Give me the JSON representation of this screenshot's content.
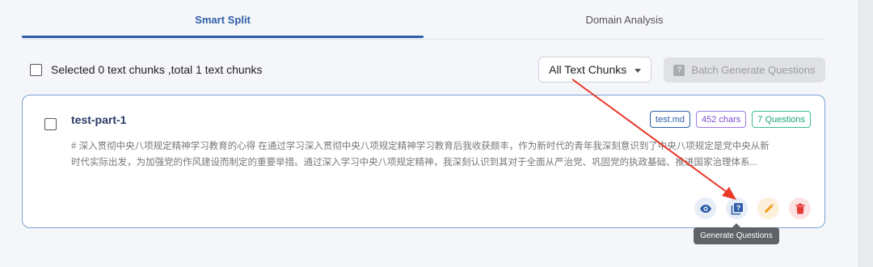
{
  "tabs": [
    {
      "label": "Smart Split",
      "active": true
    },
    {
      "label": "Domain Analysis",
      "active": false
    }
  ],
  "toolbar": {
    "selection_text": "Selected 0 text chunks ,total 1 text chunks",
    "filter_value": "All Text Chunks",
    "batch_button_label": "Batch Generate Questions",
    "batch_button_icon": "question-book-icon"
  },
  "chunk": {
    "title": "test-part-1",
    "tags": {
      "file": "test.md",
      "chars": "452 chars",
      "questions": "7 Questions"
    },
    "preview_line1": "# 深入贯彻中央八项规定精神学习教育的心得 在通过学习深入贯彻中央八项规定精神学习教育后我收获颇丰，作为新时代的青年我深刻意识到了中央八项规定是党中央从新",
    "preview_line2": "时代实际出发，为加强党的作风建设而制定的重要举措。通过深入学习中央八项规定精神，我深刻认识到其对于全面从严治党、巩固党的执政基础、推进国家治理体系...",
    "actions": [
      "eye-icon",
      "generate-questions-icon",
      "pencil-icon",
      "trash-icon"
    ]
  },
  "tooltip": "Generate Questions",
  "colors": {
    "primary": "#2f5ea8",
    "chars_tag": "#7a4ed1",
    "questions_tag": "#1fa774",
    "edit": "#f0a020",
    "delete": "#e53935",
    "annotation_arrow": "#e8392b"
  }
}
